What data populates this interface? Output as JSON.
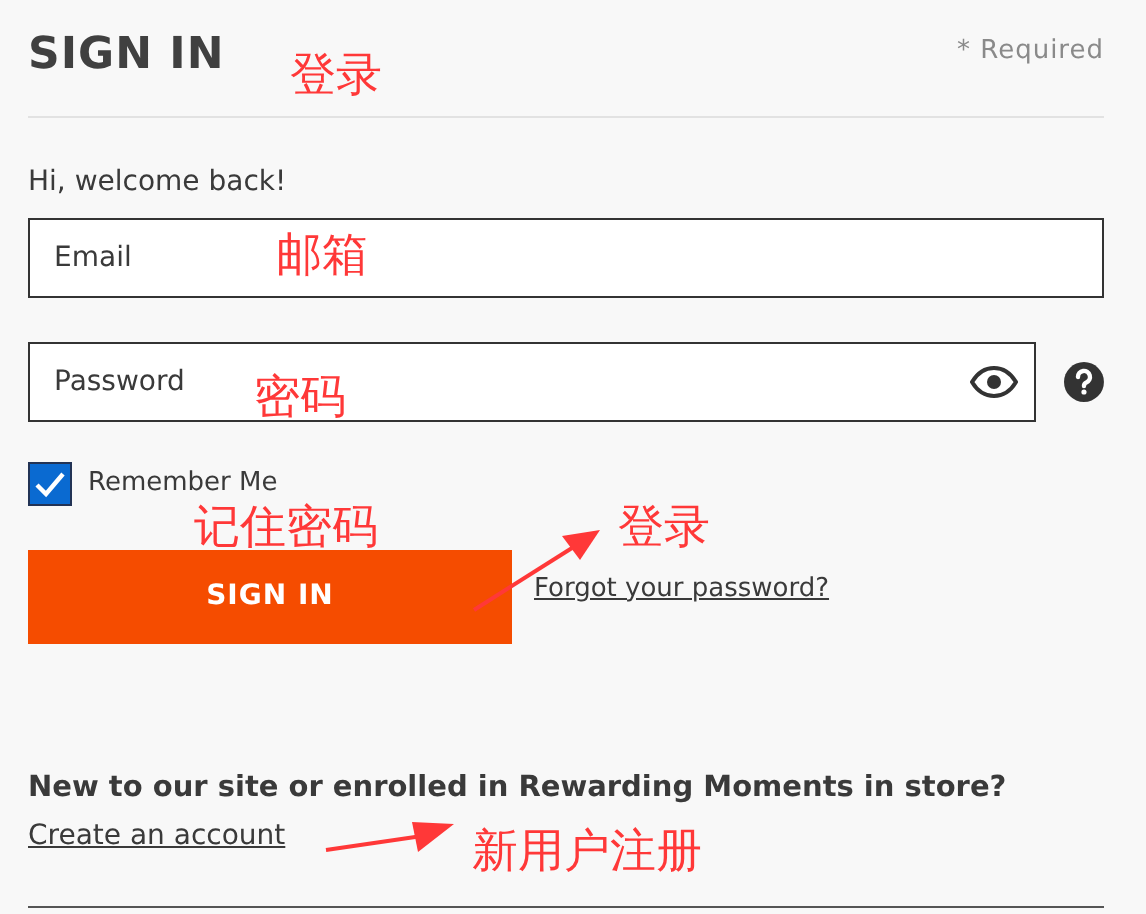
{
  "title": "SIGN IN",
  "required_note": "* Required",
  "welcome": "Hi, welcome back!",
  "email": {
    "placeholder": "Email"
  },
  "password": {
    "placeholder": "Password"
  },
  "remember": {
    "label": "Remember Me",
    "checked": true
  },
  "sign_in_button": "SIGN IN",
  "forgot_link": "Forgot your password?",
  "new_prompt": "New to our site or enrolled in Rewarding Moments in store?",
  "create_link": "Create an account",
  "annotations": [
    {
      "text": "登录"
    },
    {
      "text": "邮箱"
    },
    {
      "text": "密码"
    },
    {
      "text": "记住密码"
    },
    {
      "text": "登录"
    },
    {
      "text": "新用户注册"
    }
  ]
}
